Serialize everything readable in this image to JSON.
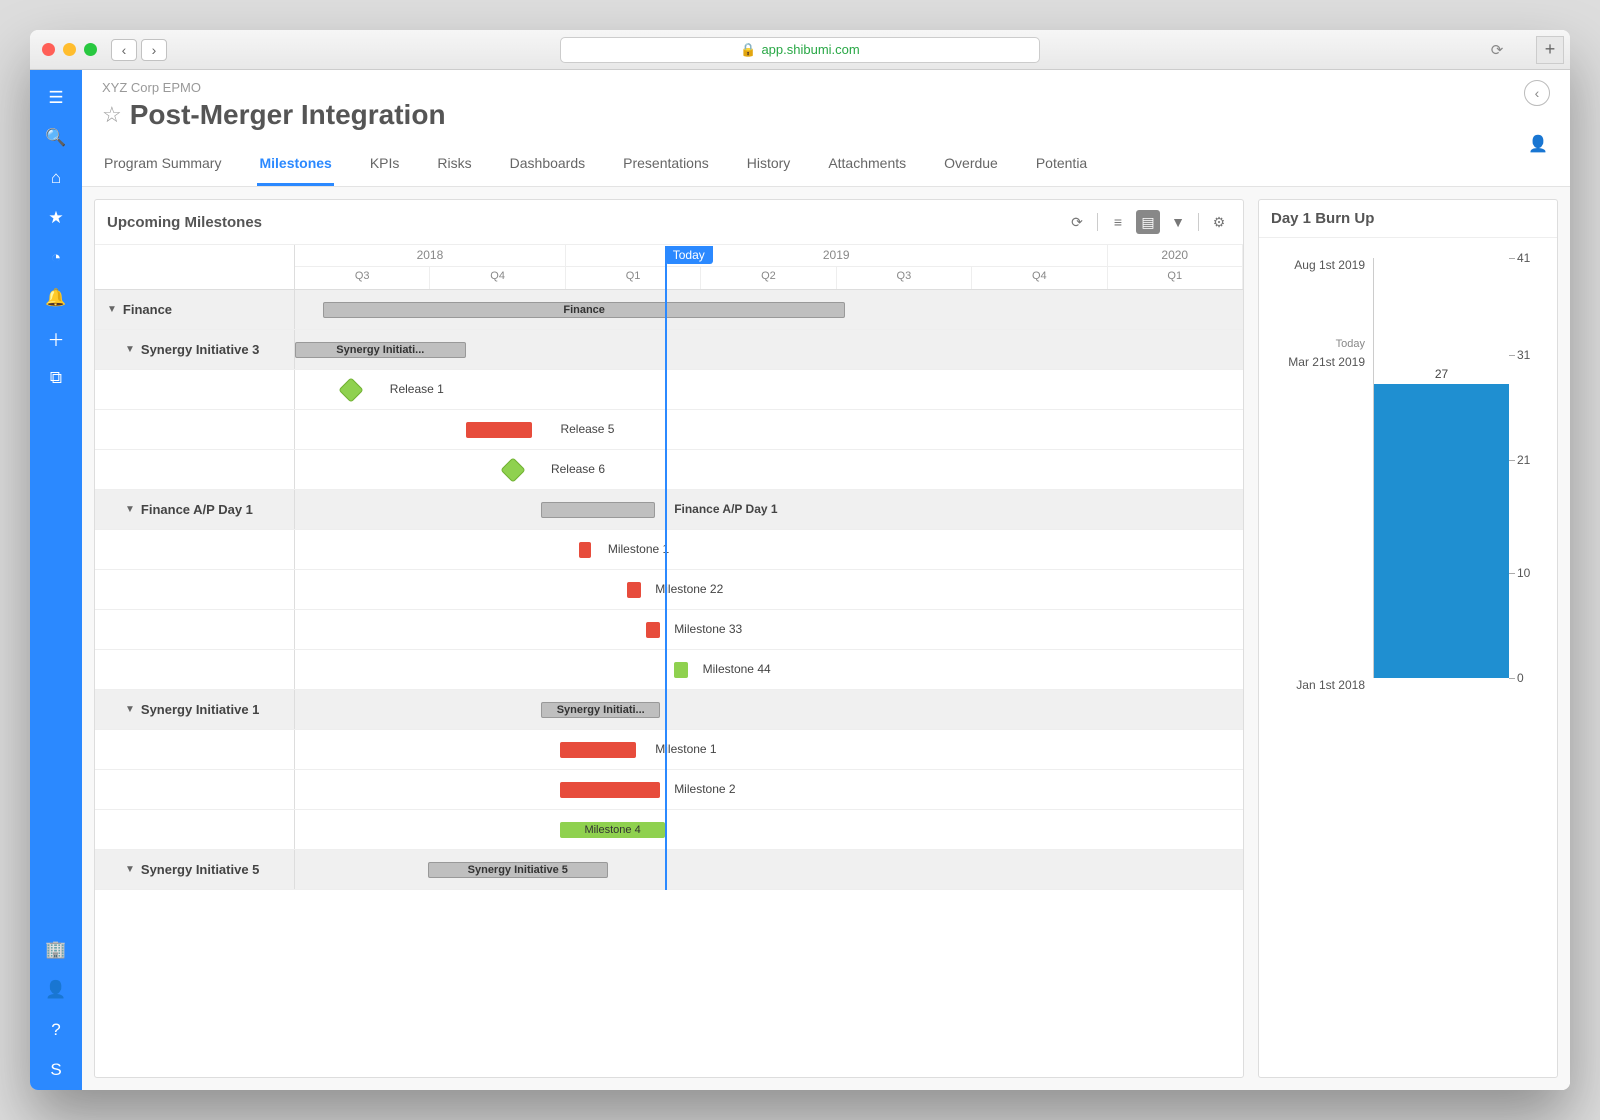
{
  "browser": {
    "url": "app.shibumi.com"
  },
  "sidebar": {
    "top": [
      {
        "icon": "menu-icon",
        "glyph": "☰"
      },
      {
        "icon": "search-icon",
        "glyph": "🔍"
      },
      {
        "icon": "home-icon",
        "glyph": "⌂"
      },
      {
        "icon": "star-icon",
        "glyph": "★"
      },
      {
        "icon": "clock-icon",
        "glyph": "◔"
      },
      {
        "icon": "bell-icon",
        "glyph": "🔔"
      },
      {
        "icon": "plus-icon",
        "glyph": "＋"
      },
      {
        "icon": "copy-icon",
        "glyph": "⧉"
      }
    ],
    "bottom": [
      {
        "icon": "building-icon",
        "glyph": "🏢"
      },
      {
        "icon": "user-icon",
        "glyph": "👤"
      },
      {
        "icon": "help-icon",
        "glyph": "?"
      },
      {
        "icon": "logo-icon",
        "glyph": "S"
      }
    ]
  },
  "header": {
    "breadcrumb": "XYZ Corp EPMO",
    "title": "Post-Merger Integration"
  },
  "tabs": [
    "Program Summary",
    "Milestones",
    "KPIs",
    "Risks",
    "Dashboards",
    "Presentations",
    "History",
    "Attachments",
    "Overdue",
    "Potentia"
  ],
  "activeTab": 1,
  "milestones": {
    "title": "Upcoming Milestones",
    "today_label": "Today",
    "years": [
      {
        "label": "2018",
        "span": 2
      },
      {
        "label": "2019",
        "span": 4
      },
      {
        "label": "2020",
        "span": 1
      }
    ],
    "quarters": [
      "Q3",
      "Q4",
      "Q1",
      "Q2",
      "Q3",
      "Q4",
      "Q1"
    ],
    "today_pct": 39,
    "rows": [
      {
        "type": "group",
        "level": 0,
        "label": "Finance",
        "bar": {
          "style": "gray",
          "start": 3,
          "end": 58,
          "text": "Finance"
        }
      },
      {
        "type": "group",
        "level": 1,
        "label": "Synergy Initiative 3",
        "bar": {
          "style": "gray",
          "start": 0,
          "end": 18,
          "text": "Synergy Initiati..."
        }
      },
      {
        "type": "item",
        "level": 1,
        "label": "",
        "diamond": {
          "style": "green",
          "at": 5
        },
        "text": "Release 1",
        "text_at": 10
      },
      {
        "type": "item",
        "level": 1,
        "label": "",
        "bar": {
          "style": "red",
          "start": 18,
          "end": 25
        },
        "text": "Release 5",
        "text_at": 28
      },
      {
        "type": "item",
        "level": 1,
        "label": "",
        "diamond": {
          "style": "green",
          "at": 22
        },
        "text": "Release 6",
        "text_at": 27
      },
      {
        "type": "group",
        "level": 1,
        "label": "Finance A/P Day 1",
        "bar": {
          "style": "gray",
          "start": 26,
          "end": 38
        },
        "text": "Finance A/P Day 1",
        "text_at": 40
      },
      {
        "type": "item",
        "level": 1,
        "label": "",
        "bar": {
          "style": "red",
          "start": 30,
          "end": 31
        },
        "text": "Milestone 1",
        "text_at": 33
      },
      {
        "type": "item",
        "level": 1,
        "label": "",
        "bar": {
          "style": "red",
          "start": 35,
          "end": 36.5
        },
        "text": "Milestone 22",
        "text_at": 38
      },
      {
        "type": "item",
        "level": 1,
        "label": "",
        "bar": {
          "style": "red",
          "start": 37,
          "end": 38.5
        },
        "text": "Milestone 33",
        "text_at": 40
      },
      {
        "type": "item",
        "level": 1,
        "label": "",
        "bar": {
          "style": "green",
          "start": 40,
          "end": 41.5
        },
        "text": "Milestone 44",
        "text_at": 43
      },
      {
        "type": "group",
        "level": 1,
        "label": "Synergy Initiative 1",
        "bar": {
          "style": "gray",
          "start": 26,
          "end": 38.5,
          "text": "Synergy Initiati..."
        }
      },
      {
        "type": "item",
        "level": 1,
        "label": "",
        "bar": {
          "style": "red",
          "start": 28,
          "end": 36
        },
        "text": "Milestone 1",
        "text_at": 38
      },
      {
        "type": "item",
        "level": 1,
        "label": "",
        "bar": {
          "style": "red",
          "start": 28,
          "end": 38.5
        },
        "text": "Milestone 2",
        "text_at": 40
      },
      {
        "type": "item",
        "level": 1,
        "label": "",
        "bar": {
          "style": "green",
          "start": 28,
          "end": 39,
          "text": "Milestone 4"
        }
      },
      {
        "type": "group",
        "level": 1,
        "label": "Synergy Initiative 5",
        "bar": {
          "style": "gray",
          "start": 14,
          "end": 33,
          "text": "Synergy Initiative 5"
        }
      }
    ]
  },
  "burnup": {
    "title": "Day 1 Burn Up",
    "left_labels": [
      {
        "text": "Aug 1st 2019",
        "pos": 0
      },
      {
        "text": "Mar 21st 2019",
        "pos": 23
      },
      {
        "text": "Jan 1st 2018",
        "pos": 100
      }
    ],
    "today_label": "Today",
    "right_ticks": [
      {
        "val": "41",
        "pos": 0
      },
      {
        "val": "31",
        "pos": 23
      },
      {
        "val": "21",
        "pos": 48
      },
      {
        "val": "10",
        "pos": 75
      },
      {
        "val": "0",
        "pos": 100
      }
    ],
    "bar_value": "27",
    "bar_top_pct": 30
  },
  "chart_data": {
    "type": "bar",
    "title": "Day 1 Burn Up",
    "y_axis_right": {
      "min": 0,
      "max": 41,
      "ticks": [
        0,
        10,
        21,
        31,
        41
      ]
    },
    "y_axis_left_dates": [
      "Jan 1st 2018",
      "Mar 21st 2019",
      "Aug 1st 2019"
    ],
    "today": "Mar 21st 2019",
    "series": [
      {
        "name": "Burn Up",
        "values": [
          27
        ]
      }
    ]
  }
}
